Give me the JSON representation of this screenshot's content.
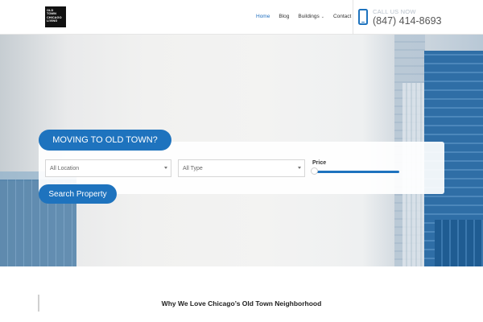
{
  "logo": {
    "lines": [
      "OLD",
      "TOWN",
      "CHICAGO",
      "LIVING"
    ]
  },
  "nav": {
    "items": [
      {
        "label": "Home",
        "active": true
      },
      {
        "label": "Blog",
        "active": false
      },
      {
        "label": "Buildings",
        "active": false,
        "has_dropdown": true
      },
      {
        "label": "Contact",
        "active": false
      }
    ]
  },
  "contact": {
    "call_label": "CALL US NOW",
    "phone": "(847) 414-8693",
    "icon": "phone-icon"
  },
  "hero": {
    "badge": "MOVING TO OLD TOWN?",
    "location_select": {
      "value": "All Location"
    },
    "type_select": {
      "value": "All Type"
    },
    "price_label": "Price",
    "search_button": "Search Property"
  },
  "section": {
    "title": "Why We Love Chicago’s Old Town Neighborhood"
  },
  "colors": {
    "accent": "#1e73be",
    "nav_active": "#1f6fbf",
    "text": "#333333"
  }
}
